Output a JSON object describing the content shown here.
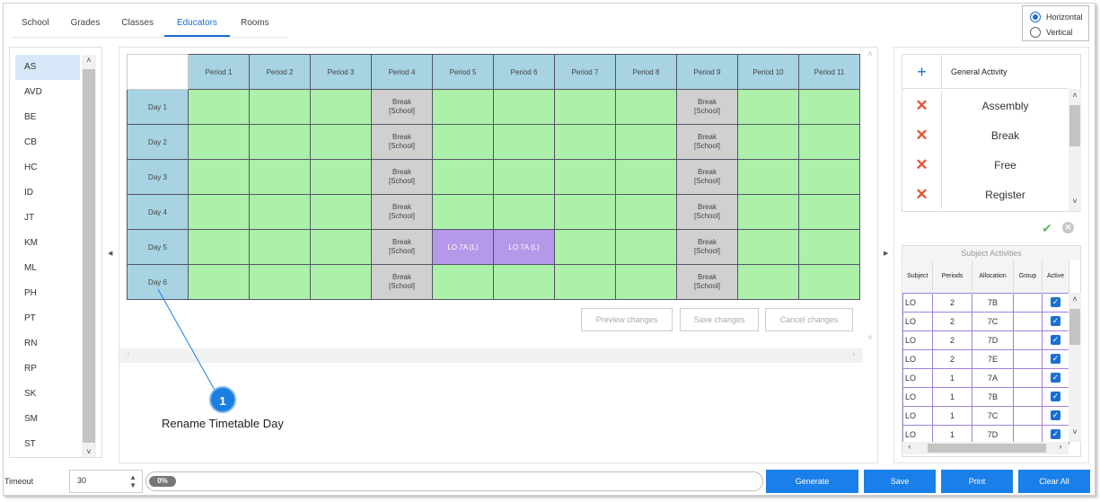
{
  "tabs": [
    "School",
    "Grades",
    "Classes",
    "Educators",
    "Rooms"
  ],
  "orientation": {
    "horizontal": "Horizontal",
    "vertical": "Vertical",
    "selected": "Horizontal"
  },
  "educators": [
    "AS",
    "AVD",
    "BE",
    "CB",
    "HC",
    "ID",
    "JT",
    "KM",
    "ML",
    "PH",
    "PT",
    "RN",
    "RP",
    "SK",
    "SM",
    "ST"
  ],
  "selected_educator": "AS",
  "periods": [
    "Period 1",
    "Period 2",
    "Period 3",
    "Period 4",
    "Period 5",
    "Period 6",
    "Period 7",
    "Period 8",
    "Period 9",
    "Period 10",
    "Period 11"
  ],
  "days": [
    "Day 1",
    "Day 2",
    "Day 3",
    "Day 4",
    "Day 5",
    "Day 6"
  ],
  "break_label": "Break",
  "break_sub": "[School]",
  "lo_label": "LO 7A (L)",
  "buttons": {
    "preview": "Preview changes",
    "save_changes": "Save changes",
    "cancel_changes": "Cancel changes",
    "generate": "Generate",
    "save": "Save",
    "print": "Print",
    "clear_all": "Clear All"
  },
  "callout": {
    "number": "1",
    "text": "Rename Timetable Day"
  },
  "activities": {
    "header": "General Activity",
    "items": [
      "Assembly",
      "Break",
      "Free",
      "Register"
    ]
  },
  "subject_activities": {
    "title": "Subject Activities",
    "columns": [
      "Subject",
      "Periods",
      "Allocation",
      "Group",
      "Active"
    ],
    "rows": [
      {
        "subject": "LO",
        "periods": "2",
        "allocation": "7B"
      },
      {
        "subject": "LO",
        "periods": "2",
        "allocation": "7C"
      },
      {
        "subject": "LO",
        "periods": "2",
        "allocation": "7D"
      },
      {
        "subject": "LO",
        "periods": "2",
        "allocation": "7E"
      },
      {
        "subject": "LO",
        "periods": "1",
        "allocation": "7A"
      },
      {
        "subject": "LO",
        "periods": "1",
        "allocation": "7B"
      },
      {
        "subject": "LO",
        "periods": "1",
        "allocation": "7C"
      },
      {
        "subject": "LO",
        "periods": "1",
        "allocation": "7D"
      }
    ]
  },
  "timeout": {
    "label": "Timeout",
    "value": "30"
  },
  "progress": {
    "text": "0%",
    "value": 0
  }
}
